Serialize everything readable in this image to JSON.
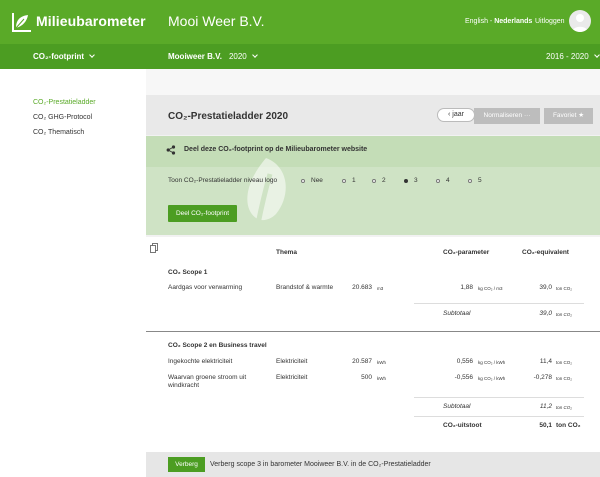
{
  "header": {
    "brand": "Milieubarometer",
    "organization": "Mooi Weer B.V.",
    "lang_en": "English",
    "lang_sep": " - ",
    "lang_nl": "Nederlands",
    "logout": "Uitloggen",
    "brand_color": "#5aaa28"
  },
  "subbar": {
    "module": "CO₂-footprint",
    "entity": "Mooiweer B.V.",
    "year": "2020",
    "period": "2016 - 2020"
  },
  "sidebar": {
    "items": [
      {
        "label": "CO₂-Prestatieladder",
        "active": true
      },
      {
        "label": "CO₂ GHG-Protocol",
        "active": false
      },
      {
        "label": "CO₂ Thematisch",
        "active": false
      }
    ]
  },
  "main": {
    "title": "CO₂-Prestatieladder 2020",
    "back_label": "‹ jaar",
    "normalize_label": "Normaliseren ···",
    "favorite_label": "Favoriet ★"
  },
  "share": {
    "title": "Deel deze CO₂-footprint op de Milieubarometer website",
    "logo_label": "Toon CO₂-Prestatieladder niveau logo",
    "options": [
      "Nee",
      "1",
      "2",
      "3",
      "4",
      "5"
    ],
    "selected": "3",
    "button": "Deel CO₂-footprint"
  },
  "table": {
    "headers": {
      "theme": "Thema",
      "parameter": "CO₂-parameter",
      "equivalent": "CO₂-equivalent"
    },
    "scope1": {
      "title": "CO₂ Scope 1",
      "rows": [
        {
          "name": "Aardgas voor verwarming",
          "theme": "Brandstof & warmte",
          "amount": "20.683",
          "amount_unit": "m3",
          "param": "1,88",
          "param_unit": "kg CO₂ / m3",
          "equiv": "39,0",
          "equiv_unit": "ton CO₂"
        }
      ],
      "subtotal_label": "Subtotaal",
      "subtotal": "39,0",
      "subtotal_unit": "ton CO₂"
    },
    "scope2": {
      "title": "CO₂ Scope 2 en Business travel",
      "rows": [
        {
          "name": "Ingekochte elektriciteit",
          "theme": "Elektriciteit",
          "amount": "20.587",
          "amount_unit": "kWh",
          "param": "0,556",
          "param_unit": "kg CO₂ / kWh",
          "equiv": "11,4",
          "equiv_unit": "ton CO₂"
        },
        {
          "name": "Waarvan groene stroom uit windkracht",
          "theme": "Elektriciteit",
          "amount": "500",
          "amount_unit": "kWh",
          "param": "-0,556",
          "param_unit": "kg CO₂ / kWh",
          "equiv": "-0,278",
          "equiv_unit": "ton CO₂"
        }
      ],
      "subtotal_label": "Subtotaal",
      "subtotal": "11,2",
      "subtotal_unit": "ton CO₂"
    },
    "total_label": "CO₂-uitstoot",
    "total": "50,1",
    "total_unit": "ton CO₂"
  },
  "bottom": {
    "button": "Verberg",
    "text": "Verberg scope 3 in barometer Mooiweer B.V. in de CO₂-Prestatieladder"
  }
}
